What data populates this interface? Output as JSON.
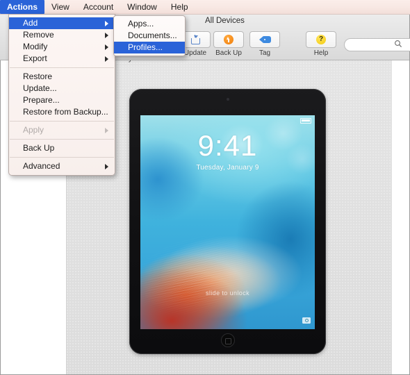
{
  "menubar": {
    "items": [
      {
        "label": "Actions",
        "active": true
      },
      {
        "label": "View",
        "active": false
      },
      {
        "label": "Account",
        "active": false
      },
      {
        "label": "Window",
        "active": false
      },
      {
        "label": "Help",
        "active": false
      }
    ]
  },
  "toolbar": {
    "title": "All Devices",
    "buttons": [
      {
        "label": "Update",
        "icon": "update-tray-icon"
      },
      {
        "label": "Back Up",
        "icon": "backup-circle-arrow-icon"
      },
      {
        "label": "Tag",
        "icon": "tag-icon"
      },
      {
        "label": "Help",
        "icon": "help-question-icon"
      }
    ],
    "search": {
      "value": "",
      "placeholder": "",
      "icon": "search-icon"
    }
  },
  "actions_menu": {
    "items": [
      {
        "label": "Add",
        "submenu": true,
        "highlight": true,
        "disabled": false
      },
      {
        "label": "Remove",
        "submenu": true,
        "highlight": false,
        "disabled": false
      },
      {
        "label": "Modify",
        "submenu": true,
        "highlight": false,
        "disabled": false
      },
      {
        "label": "Export",
        "submenu": true,
        "highlight": false,
        "disabled": false
      },
      {
        "separator": true
      },
      {
        "label": "Restore",
        "submenu": false,
        "highlight": false,
        "disabled": false
      },
      {
        "label": "Update...",
        "submenu": false,
        "highlight": false,
        "disabled": false
      },
      {
        "label": "Prepare...",
        "submenu": false,
        "highlight": false,
        "disabled": false
      },
      {
        "label": "Restore from Backup...",
        "submenu": false,
        "highlight": false,
        "disabled": false
      },
      {
        "separator": true
      },
      {
        "label": "Apply",
        "submenu": true,
        "highlight": false,
        "disabled": true
      },
      {
        "separator": true
      },
      {
        "label": "Back Up",
        "submenu": false,
        "highlight": false,
        "disabled": false
      },
      {
        "separator": true
      },
      {
        "label": "Advanced",
        "submenu": true,
        "highlight": false,
        "disabled": false
      }
    ]
  },
  "add_submenu": {
    "items": [
      {
        "label": "Apps...",
        "highlight": false
      },
      {
        "label": "Documents...",
        "highlight": false
      },
      {
        "label": "Profiles...",
        "highlight": true
      }
    ]
  },
  "sidebar": {
    "partial_label": "covery"
  },
  "device_preview": {
    "device": "iPad",
    "lock_screen": {
      "time": "9:41",
      "date": "Tuesday, January 9",
      "slide_text": "slide to unlock"
    }
  },
  "colors": {
    "menu_highlight": "#2a63d8",
    "menubar_bg": "#f7e7e2",
    "toolbar_bg": "#e3e3e3",
    "backup_icon": "#f07f0e",
    "tag_icon": "#3d8ae0",
    "help_icon": "#f3cc10",
    "update_icon": "#5a86c9"
  }
}
